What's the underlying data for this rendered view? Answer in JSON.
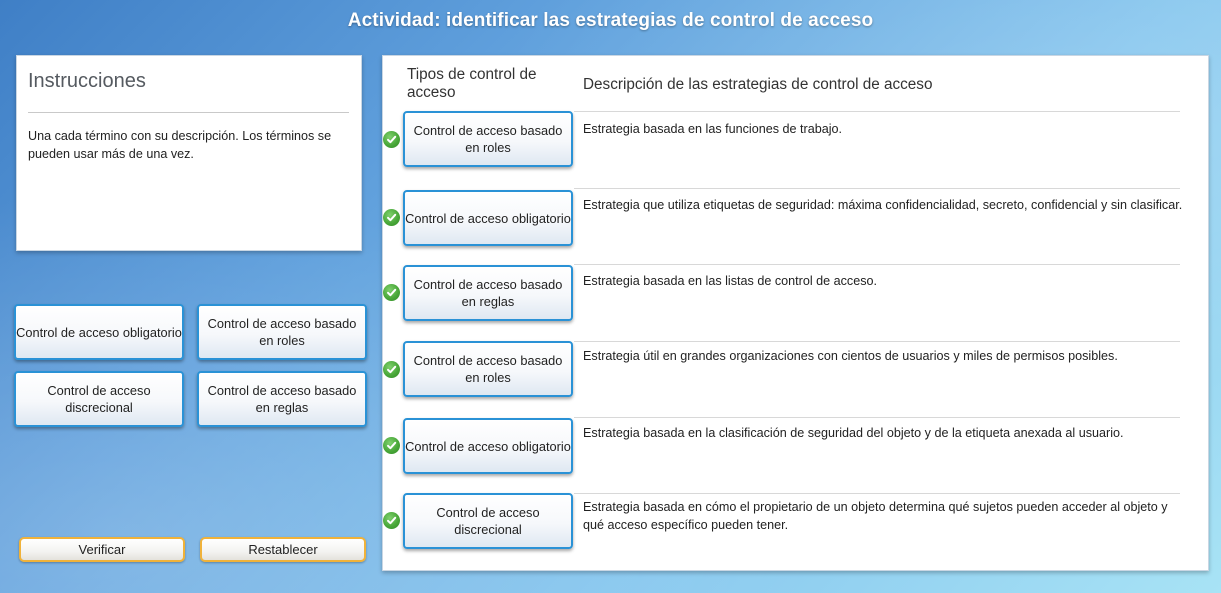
{
  "title": "Actividad: identificar las estrategias de control de acceso",
  "instructions": {
    "heading": "Instrucciones",
    "text": "Una cada término con su descripción. Los términos se pueden usar más de una vez."
  },
  "pool": [
    "Control de acceso obligatorio",
    "Control de acceso basado en roles",
    "Control de acceso discrecional",
    "Control de acceso basado en reglas"
  ],
  "buttons": {
    "verify": "Verificar",
    "reset": "Restablecer"
  },
  "table": {
    "col_types": "Tipos de control de acceso",
    "col_desc": "Descripción de las estrategias de control de acceso",
    "rows": [
      {
        "term": "Control de acceso basado en roles",
        "description": "Estrategia basada en las funciones de trabajo.",
        "correct": true
      },
      {
        "term": "Control de acceso obligatorio",
        "description": "Estrategia que utiliza etiquetas de seguridad: máxima confidencialidad, secreto, confidencial y sin clasificar.",
        "correct": true
      },
      {
        "term": "Control de acceso basado en reglas",
        "description": "Estrategia basada en las listas de control de acceso.",
        "correct": true
      },
      {
        "term": "Control de acceso basado en roles",
        "description": "Estrategia útil en grandes organizaciones con cientos de usuarios y miles de permisos posibles.",
        "correct": true
      },
      {
        "term": "Control de acceso obligatorio",
        "description": "Estrategia basada en la clasificación de seguridad del objeto y de la etiqueta anexada al usuario.",
        "correct": true
      },
      {
        "term": "Control de acceso discrecional",
        "description": "Estrategia basada en cómo el propietario de un objeto determina qué sujetos pueden acceder al objeto y qué acceso específico pueden tener.",
        "correct": true
      }
    ]
  },
  "colors": {
    "tile_border": "#2a92d6",
    "button_border": "#f0b23a",
    "check_green": "#4aa83a"
  },
  "icons": {
    "check": "check-circle-icon"
  }
}
